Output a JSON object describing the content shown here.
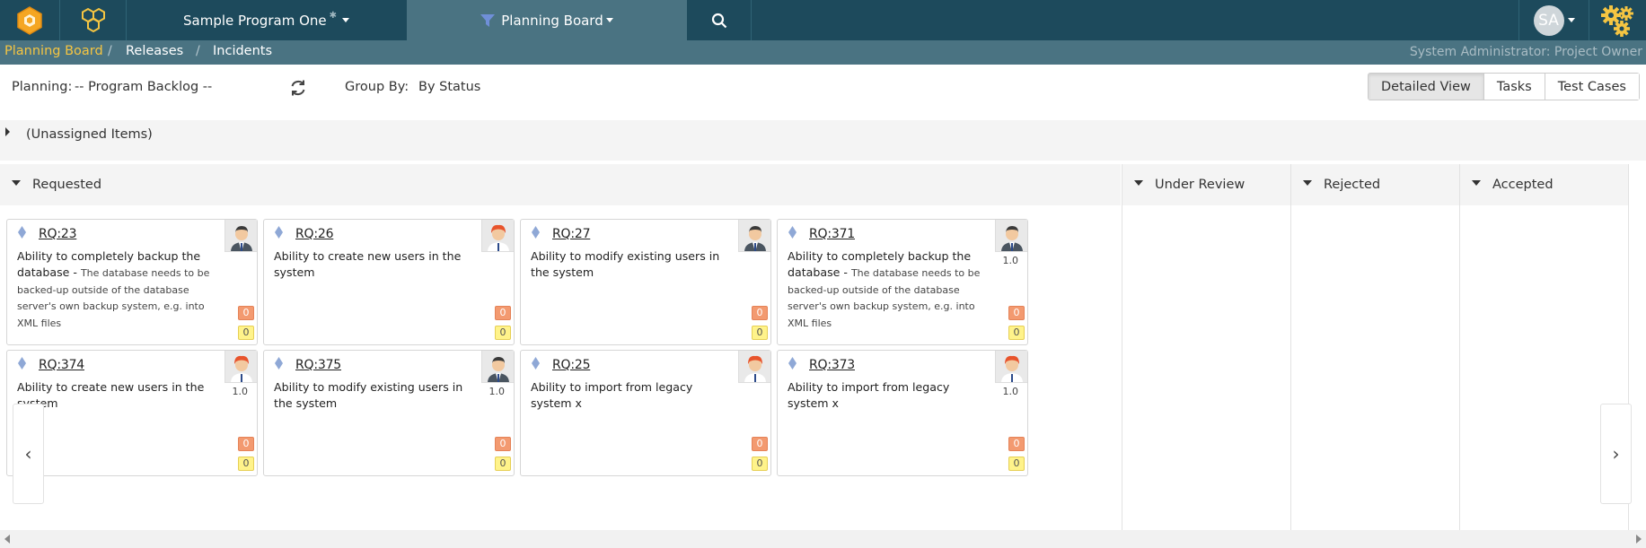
{
  "topnav": {
    "program": "Sample Program One",
    "view": "Planning Board",
    "user_initials": "SA"
  },
  "breadcrumb": {
    "items": [
      "Planning Board",
      "Releases",
      "Incidents"
    ],
    "separator": "/",
    "role": "System Administrator: Project Owner"
  },
  "toolbar": {
    "planning_label": "Planning:",
    "planning_value": "-- Program Backlog --",
    "groupby_label": "Group By:",
    "groupby_value": "By Status",
    "views": [
      "Detailed View",
      "Tasks",
      "Test Cases"
    ],
    "active_view": "Detailed View"
  },
  "unassigned": {
    "label": "(Unassigned Items)"
  },
  "columns": [
    "Requested",
    "Under Review",
    "Rejected",
    "Accepted"
  ],
  "cards": [
    {
      "id": "RQ:23",
      "title": "Ability to completely backup the database",
      "desc": "The database needs to be backed-up outside of the database server's own backup system, e.g. into XML files",
      "estimate": "",
      "tasks": "0",
      "tests": "0",
      "avatar": "male"
    },
    {
      "id": "RQ:26",
      "title": "Ability to create new users in the system",
      "desc": "",
      "estimate": "",
      "tasks": "0",
      "tests": "0",
      "avatar": "female"
    },
    {
      "id": "RQ:27",
      "title": "Ability to modify existing users in the system",
      "desc": "",
      "estimate": "",
      "tasks": "0",
      "tests": "0",
      "avatar": "male"
    },
    {
      "id": "RQ:371",
      "title": "Ability to completely backup the database",
      "desc": "The database needs to be backed-up outside of the database server's own backup system, e.g. into XML files",
      "estimate": "1.0",
      "tasks": "0",
      "tests": "0",
      "avatar": "male"
    },
    {
      "id": "RQ:374",
      "title": "Ability to create new users in the system",
      "desc": "",
      "estimate": "1.0",
      "tasks": "0",
      "tests": "0",
      "avatar": "female"
    },
    {
      "id": "RQ:375",
      "title": "Ability to modify existing users in the system",
      "desc": "",
      "estimate": "1.0",
      "tasks": "0",
      "tests": "0",
      "avatar": "male"
    },
    {
      "id": "RQ:25",
      "title": "Ability to import from legacy system x",
      "desc": "",
      "estimate": "",
      "tasks": "0",
      "tests": "0",
      "avatar": "female"
    },
    {
      "id": "RQ:373",
      "title": "Ability to import from legacy system x",
      "desc": "",
      "estimate": "1.0",
      "tasks": "0",
      "tests": "0",
      "avatar": "female"
    }
  ],
  "colors": {
    "nav_bg": "#1d4a5c",
    "crumb_bg": "#4a7382",
    "active_crumb": "#f5c542",
    "badge_orange": "#f39a70",
    "badge_yellow": "#fff38a",
    "diamond": "#8fa8d6"
  },
  "icons": [
    "honeycomb-logo-icon",
    "hive-icon",
    "gear-small-icon",
    "filter-icon",
    "search-icon",
    "gears-icon",
    "refresh-icon",
    "chevron-left-icon",
    "chevron-right-icon"
  ]
}
